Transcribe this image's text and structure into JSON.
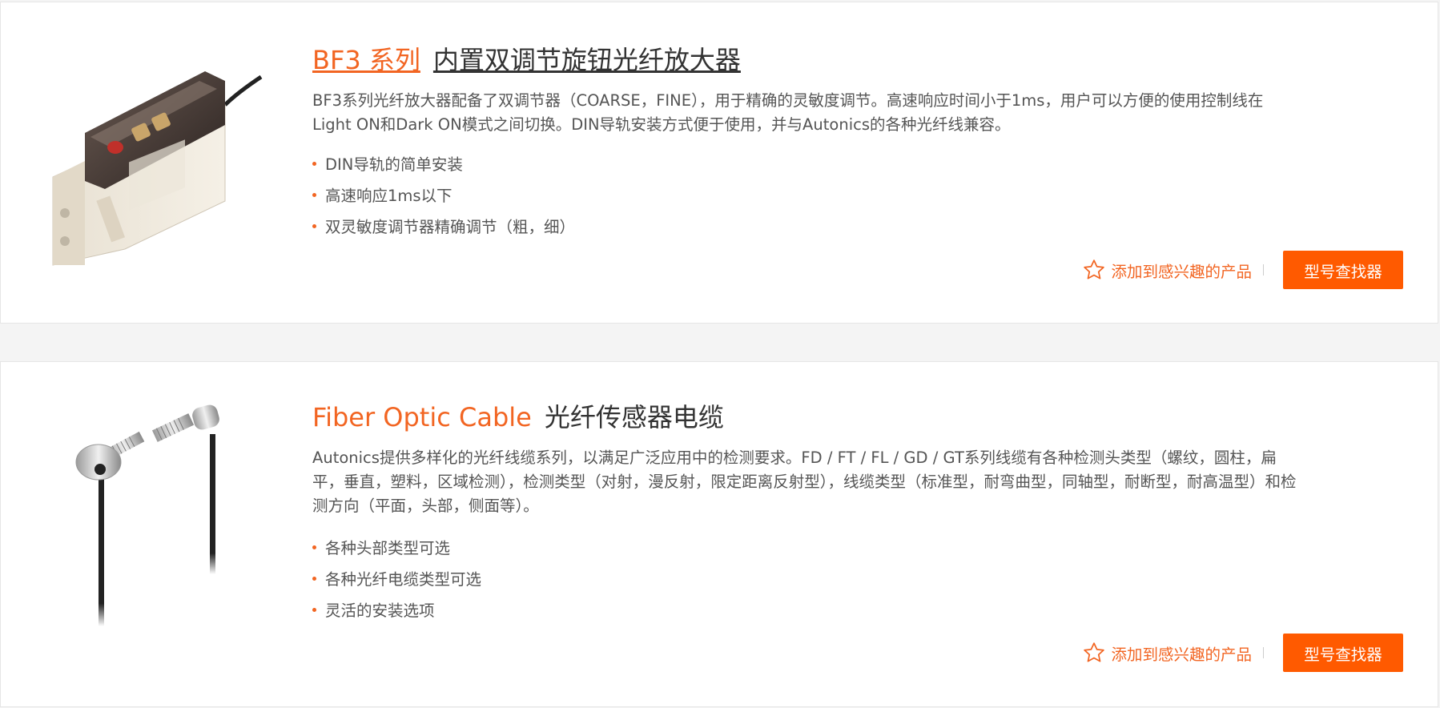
{
  "colors": {
    "accent": "#f26522",
    "button": "#ff5a00",
    "text": "#555555",
    "title": "#333333"
  },
  "products": [
    {
      "series_name": "BF3 系列",
      "product_name": "内置双调节旋钮光纤放大器",
      "image_icon": "fiber-amplifier-image",
      "description": "BF3系列光纤放大器配备了双调节器（COARSE，FINE），用于精确的灵敏度调节。高速响应时间小于1ms，用户可以方便的使用控制线在Light ON和Dark ON模式之间切换。DIN导轨安装方式便于使用，并与Autonics的各种光纤线兼容。",
      "features": [
        "DIN导轨的简单安装",
        "高速响应1ms以下",
        "双灵敏度调节器精确调节（粗，细）"
      ],
      "interest_label": "添加到感兴趣的产品",
      "finder_label": "型号查找器"
    },
    {
      "series_name": "Fiber Optic Cable",
      "product_name": "光纤传感器电缆",
      "image_icon": "fiber-optic-cable-image",
      "description": "Autonics提供多样化的光纤线缆系列，以满足广泛应用中的检测要求。FD / FT / FL / GD / GT系列线缆有各种检测头类型（螺纹，圆柱，扁平，垂直，塑料，区域检测），检测类型（对射，漫反射，限定距离反射型），线缆类型（标准型，耐弯曲型，同轴型，耐断型，耐高温型）和检测方向（平面，头部，侧面等）。",
      "features": [
        "各种头部类型可选",
        "各种光纤电缆类型可选",
        "灵活的安装选项"
      ],
      "interest_label": "添加到感兴趣的产品",
      "finder_label": "型号查找器"
    }
  ]
}
